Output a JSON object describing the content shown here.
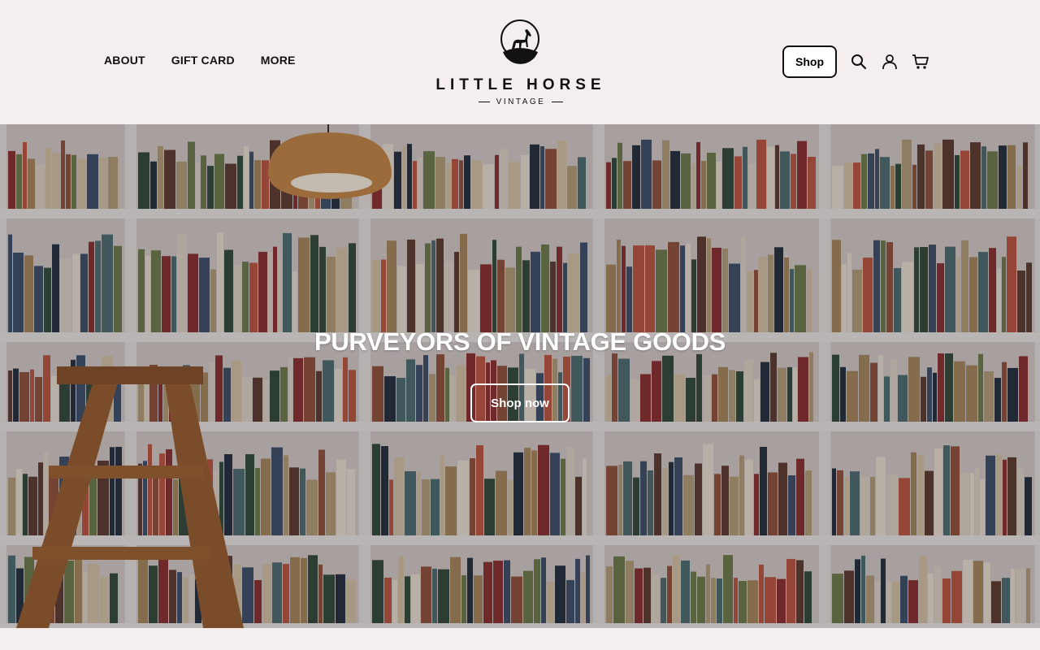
{
  "header": {
    "nav_left": [
      {
        "label": "ABOUT"
      },
      {
        "label": "GIFT CARD"
      },
      {
        "label": "MORE"
      }
    ],
    "logo": {
      "brand": "LITTLE HORSE",
      "sub": "VINTAGE",
      "icon": "horse-icon"
    },
    "shop_label": "Shop",
    "icons": [
      "search-icon",
      "account-icon",
      "cart-icon"
    ]
  },
  "hero": {
    "title": "PURVEYORS OF VINTAGE GOODS",
    "button_label": "Shop now",
    "background": "bookshelves-photo"
  },
  "colors": {
    "page_bg": "#f4efee",
    "text": "#111111",
    "hero_text": "#ffffff"
  }
}
